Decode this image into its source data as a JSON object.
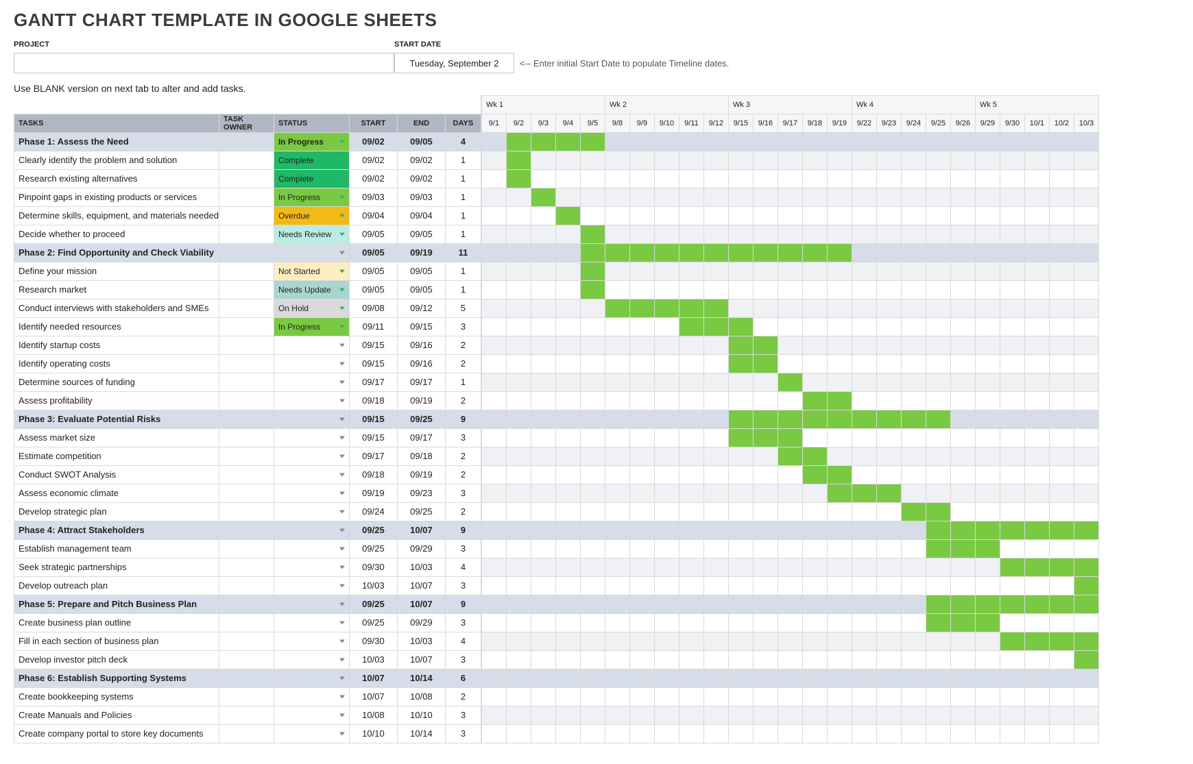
{
  "title": "GANTT CHART TEMPLATE IN GOOGLE SHEETS",
  "labels": {
    "project": "PROJECT",
    "start_date": "START DATE",
    "hint": "<-- Enter initial Start Date to populate Timeline dates.",
    "instruction": "Use BLANK version on next tab to alter and add tasks.",
    "tasks": "TASKS",
    "task_owner": "TASK OWNER",
    "status": "STATUS",
    "start": "START",
    "end": "END",
    "days": "DAYS"
  },
  "inputs": {
    "project_name": "",
    "start_date_value": "Tuesday, September 2"
  },
  "status_colors": {
    "In Progress": "#7ac943",
    "Complete": "#1fb866",
    "Overdue": "#f5b915",
    "Needs Review": "#b9ede2",
    "Not Started": "#fdeec2",
    "Needs Update": "#a8d6d0",
    "On Hold": "#d9d9d9"
  },
  "weeks": [
    {
      "label": "Wk 1",
      "days": [
        "9/1",
        "9/2",
        "9/3",
        "9/4",
        "9/5"
      ]
    },
    {
      "label": "Wk 2",
      "days": [
        "9/8",
        "9/9",
        "9/10",
        "9/11",
        "9/12"
      ]
    },
    {
      "label": "Wk 3",
      "days": [
        "9/15",
        "9/16",
        "9/17",
        "9/18",
        "9/19"
      ]
    },
    {
      "label": "Wk 4",
      "days": [
        "9/22",
        "9/23",
        "9/24",
        "9/25",
        "9/26"
      ]
    },
    {
      "label": "Wk 5",
      "days": [
        "9/29",
        "9/30",
        "10/1",
        "10/2",
        "10/3"
      ]
    }
  ],
  "rows": [
    {
      "type": "phase",
      "task": "Phase 1: Assess the Need",
      "status": "In Progress",
      "start": "09/02",
      "end": "09/05",
      "days": "4",
      "bar": [
        1,
        4
      ]
    },
    {
      "type": "task",
      "task": "Clearly identify the problem and solution",
      "status": "Complete",
      "start": "09/02",
      "end": "09/02",
      "days": "1",
      "bar": [
        1,
        1
      ]
    },
    {
      "type": "task",
      "task": "Research existing alternatives",
      "status": "Complete",
      "start": "09/02",
      "end": "09/02",
      "days": "1",
      "bar": [
        1,
        1
      ]
    },
    {
      "type": "task",
      "task": "Pinpoint gaps in existing products or services",
      "status": "In Progress",
      "start": "09/03",
      "end": "09/03",
      "days": "1",
      "bar": [
        2,
        2
      ]
    },
    {
      "type": "task",
      "task": "Determine skills, equipment, and materials needed",
      "status": "Overdue",
      "start": "09/04",
      "end": "09/04",
      "days": "1",
      "bar": [
        3,
        3
      ]
    },
    {
      "type": "task",
      "task": "Decide whether to proceed",
      "status": "Needs Review",
      "start": "09/05",
      "end": "09/05",
      "days": "1",
      "bar": [
        4,
        4
      ]
    },
    {
      "type": "phase",
      "task": "Phase 2: Find Opportunity and Check Viability",
      "status": "",
      "start": "09/05",
      "end": "09/19",
      "days": "11",
      "bar": [
        4,
        14
      ]
    },
    {
      "type": "task",
      "task": "Define your mission",
      "status": "Not Started",
      "start": "09/05",
      "end": "09/05",
      "days": "1",
      "bar": [
        4,
        4
      ]
    },
    {
      "type": "task",
      "task": "Research market",
      "status": "Needs Update",
      "start": "09/05",
      "end": "09/05",
      "days": "1",
      "bar": [
        4,
        4
      ]
    },
    {
      "type": "task",
      "task": "Conduct interviews with stakeholders and SMEs",
      "status": "On Hold",
      "start": "09/08",
      "end": "09/12",
      "days": "5",
      "bar": [
        5,
        9
      ]
    },
    {
      "type": "task",
      "task": "Identify needed resources",
      "status": "In Progress",
      "start": "09/11",
      "end": "09/15",
      "days": "3",
      "bar": [
        8,
        10
      ]
    },
    {
      "type": "task",
      "task": "Identify startup costs",
      "status": "",
      "start": "09/15",
      "end": "09/16",
      "days": "2",
      "bar": [
        10,
        11
      ]
    },
    {
      "type": "task",
      "task": "Identify operating costs",
      "status": "",
      "start": "09/15",
      "end": "09/16",
      "days": "2",
      "bar": [
        10,
        11
      ]
    },
    {
      "type": "task",
      "task": "Determine sources of funding",
      "status": "",
      "start": "09/17",
      "end": "09/17",
      "days": "1",
      "bar": [
        12,
        12
      ]
    },
    {
      "type": "task",
      "task": "Assess profitability",
      "status": "",
      "start": "09/18",
      "end": "09/19",
      "days": "2",
      "bar": [
        13,
        14
      ]
    },
    {
      "type": "phase",
      "task": "Phase 3: Evaluate Potential Risks",
      "status": "",
      "start": "09/15",
      "end": "09/25",
      "days": "9",
      "bar": [
        10,
        18
      ]
    },
    {
      "type": "task",
      "task": "Assess market size",
      "status": "",
      "start": "09/15",
      "end": "09/17",
      "days": "3",
      "bar": [
        10,
        12
      ]
    },
    {
      "type": "task",
      "task": "Estimate competition",
      "status": "",
      "start": "09/17",
      "end": "09/18",
      "days": "2",
      "bar": [
        12,
        13
      ]
    },
    {
      "type": "task",
      "task": "Conduct SWOT Analysis",
      "status": "",
      "start": "09/18",
      "end": "09/19",
      "days": "2",
      "bar": [
        13,
        14
      ]
    },
    {
      "type": "task",
      "task": "Assess economic climate",
      "status": "",
      "start": "09/19",
      "end": "09/23",
      "days": "3",
      "bar": [
        14,
        16
      ]
    },
    {
      "type": "task",
      "task": "Develop strategic plan",
      "status": "",
      "start": "09/24",
      "end": "09/25",
      "days": "2",
      "bar": [
        17,
        18
      ]
    },
    {
      "type": "phase",
      "task": "Phase 4: Attract Stakeholders",
      "status": "",
      "start": "09/25",
      "end": "10/07",
      "days": "9",
      "bar": [
        18,
        24
      ]
    },
    {
      "type": "task",
      "task": "Establish management team",
      "status": "",
      "start": "09/25",
      "end": "09/29",
      "days": "3",
      "bar": [
        18,
        20
      ]
    },
    {
      "type": "task",
      "task": "Seek strategic partnerships",
      "status": "",
      "start": "09/30",
      "end": "10/03",
      "days": "4",
      "bar": [
        21,
        24
      ]
    },
    {
      "type": "task",
      "task": "Develop outreach plan",
      "status": "",
      "start": "10/03",
      "end": "10/07",
      "days": "3",
      "bar": [
        24,
        24
      ]
    },
    {
      "type": "phase",
      "task": "Phase 5: Prepare and Pitch Business Plan",
      "status": "",
      "start": "09/25",
      "end": "10/07",
      "days": "9",
      "bar": [
        18,
        24
      ]
    },
    {
      "type": "task",
      "task": "Create business plan outline",
      "status": "",
      "start": "09/25",
      "end": "09/29",
      "days": "3",
      "bar": [
        18,
        20
      ]
    },
    {
      "type": "task",
      "task": "Fill in each section of business plan",
      "status": "",
      "start": "09/30",
      "end": "10/03",
      "days": "4",
      "bar": [
        21,
        24
      ]
    },
    {
      "type": "task",
      "task": "Develop investor pitch deck",
      "status": "",
      "start": "10/03",
      "end": "10/07",
      "days": "3",
      "bar": [
        24,
        24
      ]
    },
    {
      "type": "phase",
      "task": "Phase 6: Establish Supporting Systems",
      "status": "",
      "start": "10/07",
      "end": "10/14",
      "days": "6",
      "bar": null
    },
    {
      "type": "task",
      "task": "Create bookkeeping systems",
      "status": "",
      "start": "10/07",
      "end": "10/08",
      "days": "2",
      "bar": null
    },
    {
      "type": "task",
      "task": "Create Manuals and Policies",
      "status": "",
      "start": "10/08",
      "end": "10/10",
      "days": "3",
      "bar": null
    },
    {
      "type": "task",
      "task": "Create company portal to store key documents",
      "status": "",
      "start": "10/10",
      "end": "10/14",
      "days": "3",
      "bar": null
    }
  ],
  "chart_data": {
    "type": "gantt",
    "title": "Gantt Chart Template in Google Sheets",
    "x_axis_start": "9/1",
    "x_axis_end": "10/3",
    "weeks": [
      "Wk 1",
      "Wk 2",
      "Wk 3",
      "Wk 4",
      "Wk 5"
    ],
    "tasks": [
      {
        "name": "Phase 1: Assess the Need",
        "start": "09/02",
        "end": "09/05",
        "days": 4,
        "status": "In Progress",
        "phase": true
      },
      {
        "name": "Clearly identify the problem and solution",
        "start": "09/02",
        "end": "09/02",
        "days": 1,
        "status": "Complete"
      },
      {
        "name": "Research existing alternatives",
        "start": "09/02",
        "end": "09/02",
        "days": 1,
        "status": "Complete"
      },
      {
        "name": "Pinpoint gaps in existing products or services",
        "start": "09/03",
        "end": "09/03",
        "days": 1,
        "status": "In Progress"
      },
      {
        "name": "Determine skills, equipment, and materials needed",
        "start": "09/04",
        "end": "09/04",
        "days": 1,
        "status": "Overdue"
      },
      {
        "name": "Decide whether to proceed",
        "start": "09/05",
        "end": "09/05",
        "days": 1,
        "status": "Needs Review"
      },
      {
        "name": "Phase 2: Find Opportunity and Check Viability",
        "start": "09/05",
        "end": "09/19",
        "days": 11,
        "phase": true
      },
      {
        "name": "Define your mission",
        "start": "09/05",
        "end": "09/05",
        "days": 1,
        "status": "Not Started"
      },
      {
        "name": "Research market",
        "start": "09/05",
        "end": "09/05",
        "days": 1,
        "status": "Needs Update"
      },
      {
        "name": "Conduct interviews with stakeholders and SMEs",
        "start": "09/08",
        "end": "09/12",
        "days": 5,
        "status": "On Hold"
      },
      {
        "name": "Identify needed resources",
        "start": "09/11",
        "end": "09/15",
        "days": 3,
        "status": "In Progress"
      },
      {
        "name": "Identify startup costs",
        "start": "09/15",
        "end": "09/16",
        "days": 2
      },
      {
        "name": "Identify operating costs",
        "start": "09/15",
        "end": "09/16",
        "days": 2
      },
      {
        "name": "Determine sources of funding",
        "start": "09/17",
        "end": "09/17",
        "days": 1
      },
      {
        "name": "Assess profitability",
        "start": "09/18",
        "end": "09/19",
        "days": 2
      },
      {
        "name": "Phase 3: Evaluate Potential Risks",
        "start": "09/15",
        "end": "09/25",
        "days": 9,
        "phase": true
      },
      {
        "name": "Assess market size",
        "start": "09/15",
        "end": "09/17",
        "days": 3
      },
      {
        "name": "Estimate competition",
        "start": "09/17",
        "end": "09/18",
        "days": 2
      },
      {
        "name": "Conduct SWOT Analysis",
        "start": "09/18",
        "end": "09/19",
        "days": 2
      },
      {
        "name": "Assess economic climate",
        "start": "09/19",
        "end": "09/23",
        "days": 3
      },
      {
        "name": "Develop strategic plan",
        "start": "09/24",
        "end": "09/25",
        "days": 2
      },
      {
        "name": "Phase 4: Attract Stakeholders",
        "start": "09/25",
        "end": "10/07",
        "days": 9,
        "phase": true
      },
      {
        "name": "Establish management team",
        "start": "09/25",
        "end": "09/29",
        "days": 3
      },
      {
        "name": "Seek strategic partnerships",
        "start": "09/30",
        "end": "10/03",
        "days": 4
      },
      {
        "name": "Develop outreach plan",
        "start": "10/03",
        "end": "10/07",
        "days": 3
      },
      {
        "name": "Phase 5: Prepare and Pitch Business Plan",
        "start": "09/25",
        "end": "10/07",
        "days": 9,
        "phase": true
      },
      {
        "name": "Create business plan outline",
        "start": "09/25",
        "end": "09/29",
        "days": 3
      },
      {
        "name": "Fill in each section of business plan",
        "start": "09/30",
        "end": "10/03",
        "days": 4
      },
      {
        "name": "Develop investor pitch deck",
        "start": "10/03",
        "end": "10/07",
        "days": 3
      },
      {
        "name": "Phase 6: Establish Supporting Systems",
        "start": "10/07",
        "end": "10/14",
        "days": 6,
        "phase": true
      },
      {
        "name": "Create bookkeeping systems",
        "start": "10/07",
        "end": "10/08",
        "days": 2
      },
      {
        "name": "Create Manuals and Policies",
        "start": "10/08",
        "end": "10/10",
        "days": 3
      },
      {
        "name": "Create company portal to store key documents",
        "start": "10/10",
        "end": "10/14",
        "days": 3
      }
    ]
  }
}
